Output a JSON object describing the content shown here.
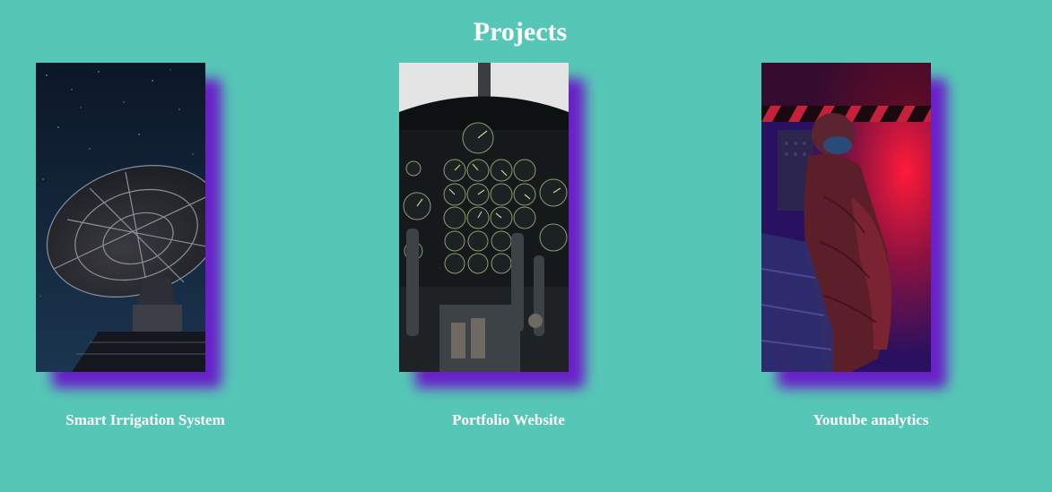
{
  "section": {
    "title": "Projects"
  },
  "projects": [
    {
      "label": "Smart Irrigation System",
      "image_icon": "satellite-dish-icon"
    },
    {
      "label": "Portfolio Website",
      "image_icon": "cockpit-icon"
    },
    {
      "label": "Youtube analytics",
      "image_icon": "astronaut-icon"
    }
  ],
  "colors": {
    "background": "#56c6b6",
    "shadow": "#6a1fc9",
    "text": "#ffffff"
  }
}
